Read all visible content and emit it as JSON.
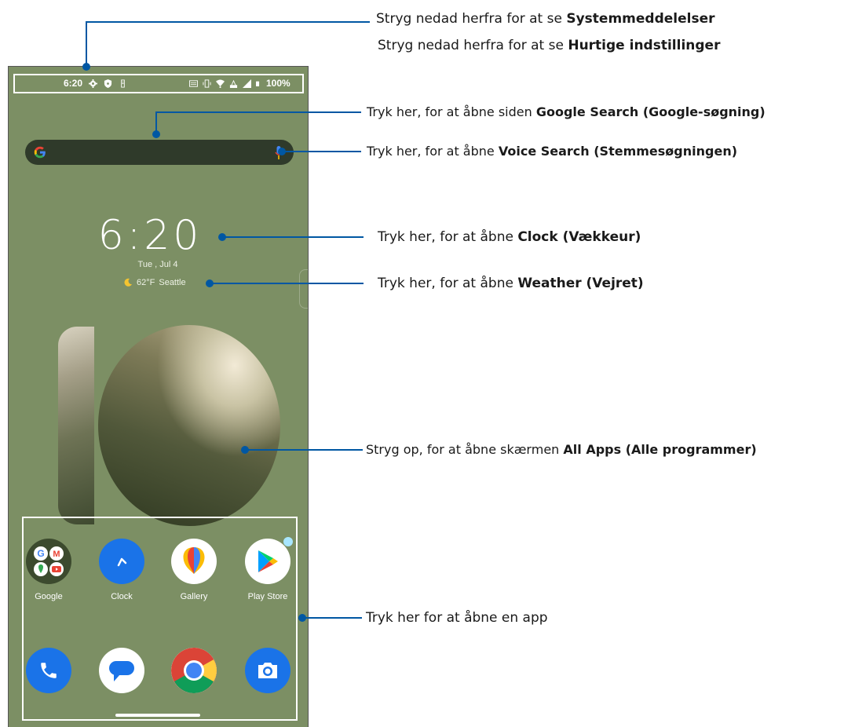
{
  "status_bar": {
    "time": "6:20",
    "battery": "100%",
    "icons": [
      "settings-gear-icon",
      "shield-icon",
      "notification-icon",
      "cast-icon",
      "vibrate-icon",
      "wifi-icon",
      "lte-icon",
      "signal-icon",
      "battery-icon"
    ]
  },
  "search": {
    "logo": "G",
    "mic": "mic-icon"
  },
  "clock_widget": {
    "time": "6:20",
    "date": "Tue , Jul 4",
    "temperature": "62°F",
    "city": "Seattle"
  },
  "apps_row1": [
    {
      "label": "Google",
      "icon": "google-folder-icon"
    },
    {
      "label": "Clock",
      "icon": "clock-icon"
    },
    {
      "label": "Gallery",
      "icon": "gallery-icon"
    },
    {
      "label": "Play Store",
      "icon": "play-store-icon"
    }
  ],
  "apps_row2": [
    {
      "icon": "phone-icon"
    },
    {
      "icon": "messages-icon"
    },
    {
      "icon": "chrome-icon"
    },
    {
      "icon": "camera-icon"
    }
  ],
  "callouts": {
    "systemmeddelelser": {
      "prefix": "Stryg nedad herfra for at se ",
      "bold": "Systemmeddelelser"
    },
    "hurtige": {
      "prefix": "Stryg nedad herfra for at se ",
      "bold": "Hurtige indstillinger"
    },
    "google_search": {
      "prefix": "Tryk her, for at åbne siden ",
      "bold": "Google Search (Google-søgning)"
    },
    "voice_search": {
      "prefix": "Tryk her, for at åbne ",
      "bold": "Voice Search (Stemmesøgningen)"
    },
    "clock": {
      "prefix": "Tryk her, for at åbne ",
      "bold": "Clock (Vækkeur)"
    },
    "weather": {
      "prefix": "Tryk her, for at åbne ",
      "bold": "Weather (Vejret)"
    },
    "all_apps": {
      "prefix": "Stryg op, for at åbne skærmen ",
      "bold": "All Apps (Alle programmer)"
    },
    "open_app": {
      "prefix": "Tryk her for at åbne en app",
      "bold": ""
    }
  },
  "colors": {
    "wallpaper": "#7c8f64",
    "callout_line": "#0057a3",
    "search_bar": "#2f3a2a"
  }
}
